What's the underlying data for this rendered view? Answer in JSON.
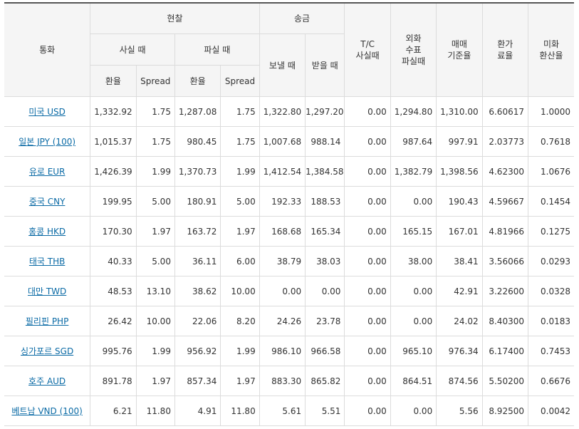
{
  "header": {
    "currency": "통화",
    "cash": "현찰",
    "cash_buy": "사실 때",
    "cash_sell": "파실 때",
    "remit": "송금",
    "remit_send": "보낼 때",
    "remit_receive": "받을 때",
    "tc_sell_line1": "T/C",
    "tc_sell_line2": "사실때",
    "check_sell_line1": "외화",
    "check_sell_line2": "수표",
    "check_sell_line3": "파실때",
    "base_rate_line1": "매매",
    "base_rate_line2": "기준율",
    "conv_rate_line1": "환가",
    "conv_rate_line2": "료율",
    "usd_rate_line1": "미화",
    "usd_rate_line2": "환산율",
    "rate": "환율",
    "spread": "Spread"
  },
  "rows": [
    {
      "currency": "미국 USD",
      "buy_rate": "1,332.92",
      "buy_spread": "1.75",
      "sell_rate": "1,287.08",
      "sell_spread": "1.75",
      "send": "1,322.80",
      "receive": "1,297.20",
      "tc": "0.00",
      "check": "1,294.80",
      "base": "1,310.00",
      "conv": "6.60617",
      "usd": "1.0000"
    },
    {
      "currency": "일본 JPY (100)",
      "buy_rate": "1,015.37",
      "buy_spread": "1.75",
      "sell_rate": "980.45",
      "sell_spread": "1.75",
      "send": "1,007.68",
      "receive": "988.14",
      "tc": "0.00",
      "check": "987.64",
      "base": "997.91",
      "conv": "2.03773",
      "usd": "0.7618"
    },
    {
      "currency": "유로 EUR",
      "buy_rate": "1,426.39",
      "buy_spread": "1.99",
      "sell_rate": "1,370.73",
      "sell_spread": "1.99",
      "send": "1,412.54",
      "receive": "1,384.58",
      "tc": "0.00",
      "check": "1,382.79",
      "base": "1,398.56",
      "conv": "4.62300",
      "usd": "1.0676"
    },
    {
      "currency": "중국 CNY",
      "buy_rate": "199.95",
      "buy_spread": "5.00",
      "sell_rate": "180.91",
      "sell_spread": "5.00",
      "send": "192.33",
      "receive": "188.53",
      "tc": "0.00",
      "check": "0.00",
      "base": "190.43",
      "conv": "4.59667",
      "usd": "0.1454"
    },
    {
      "currency": "홍콩 HKD",
      "buy_rate": "170.30",
      "buy_spread": "1.97",
      "sell_rate": "163.72",
      "sell_spread": "1.97",
      "send": "168.68",
      "receive": "165.34",
      "tc": "0.00",
      "check": "165.15",
      "base": "167.01",
      "conv": "4.81966",
      "usd": "0.1275"
    },
    {
      "currency": "태국 THB",
      "buy_rate": "40.33",
      "buy_spread": "5.00",
      "sell_rate": "36.11",
      "sell_spread": "6.00",
      "send": "38.79",
      "receive": "38.03",
      "tc": "0.00",
      "check": "38.00",
      "base": "38.41",
      "conv": "3.56066",
      "usd": "0.0293"
    },
    {
      "currency": "대만 TWD",
      "buy_rate": "48.53",
      "buy_spread": "13.10",
      "sell_rate": "38.62",
      "sell_spread": "10.00",
      "send": "0.00",
      "receive": "0.00",
      "tc": "0.00",
      "check": "0.00",
      "base": "42.91",
      "conv": "3.22600",
      "usd": "0.0328"
    },
    {
      "currency": "필리핀 PHP",
      "buy_rate": "26.42",
      "buy_spread": "10.00",
      "sell_rate": "22.06",
      "sell_spread": "8.20",
      "send": "24.26",
      "receive": "23.78",
      "tc": "0.00",
      "check": "0.00",
      "base": "24.02",
      "conv": "8.40300",
      "usd": "0.0183"
    },
    {
      "currency": "싱가포르 SGD",
      "buy_rate": "995.76",
      "buy_spread": "1.99",
      "sell_rate": "956.92",
      "sell_spread": "1.99",
      "send": "986.10",
      "receive": "966.58",
      "tc": "0.00",
      "check": "965.10",
      "base": "976.34",
      "conv": "6.17400",
      "usd": "0.7453"
    },
    {
      "currency": "호주 AUD",
      "buy_rate": "891.78",
      "buy_spread": "1.97",
      "sell_rate": "857.34",
      "sell_spread": "1.97",
      "send": "883.30",
      "receive": "865.82",
      "tc": "0.00",
      "check": "864.51",
      "base": "874.56",
      "conv": "5.50200",
      "usd": "0.6676"
    },
    {
      "currency": "베트남 VND (100)",
      "buy_rate": "6.21",
      "buy_spread": "11.80",
      "sell_rate": "4.91",
      "sell_spread": "11.80",
      "send": "5.61",
      "receive": "5.51",
      "tc": "0.00",
      "check": "0.00",
      "base": "5.56",
      "conv": "8.92500",
      "usd": "0.0042"
    }
  ]
}
